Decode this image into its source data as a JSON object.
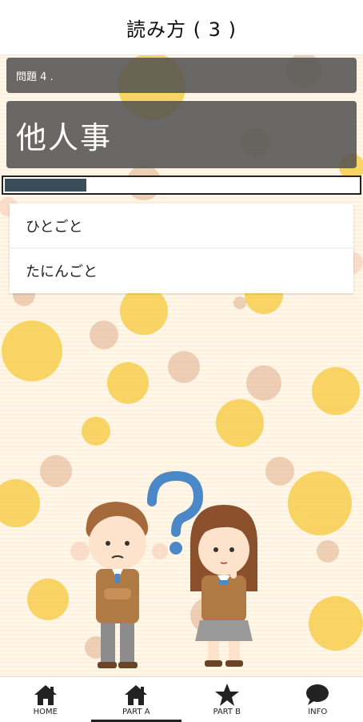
{
  "header": {
    "title": "読み方 ( 3 )"
  },
  "question": {
    "label": "問題 4 .",
    "word": "他人事",
    "progress_fraction": 0.23
  },
  "answers": [
    {
      "label": "ひとごと"
    },
    {
      "label": "たにんごと"
    }
  ],
  "tabbar": {
    "items": [
      {
        "label": "HOME",
        "icon": "house-icon"
      },
      {
        "label": "PART A",
        "icon": "house-icon"
      },
      {
        "label": "PART B",
        "icon": "star-icon"
      },
      {
        "label": "INFO",
        "icon": "speech-bubble-icon"
      }
    ],
    "active_index": 1
  },
  "colors": {
    "panel": "#505050",
    "progress_fill": "#3c4d5a",
    "question_mark": "#4a88c7"
  }
}
